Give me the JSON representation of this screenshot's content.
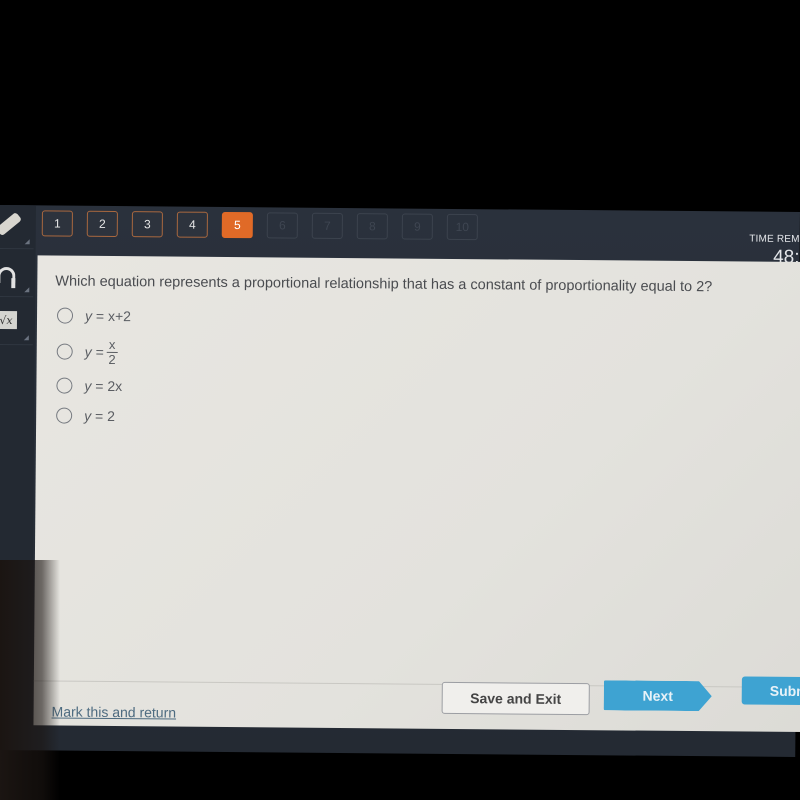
{
  "toolbar": {
    "tools": [
      {
        "name": "pencil",
        "icon": "pencil-icon"
      },
      {
        "name": "text-to-speech",
        "icon": "headphones-icon"
      },
      {
        "name": "calculator",
        "icon": "square-root-icon",
        "glyph": "√x"
      }
    ]
  },
  "question_nav": {
    "items": [
      {
        "label": "1",
        "state": "answered"
      },
      {
        "label": "2",
        "state": "answered"
      },
      {
        "label": "3",
        "state": "answered"
      },
      {
        "label": "4",
        "state": "answered"
      },
      {
        "label": "5",
        "state": "current"
      },
      {
        "label": "6",
        "state": "locked"
      },
      {
        "label": "7",
        "state": "locked"
      },
      {
        "label": "8",
        "state": "locked"
      },
      {
        "label": "9",
        "state": "locked"
      },
      {
        "label": "10",
        "state": "locked"
      }
    ]
  },
  "timer": {
    "label": "TIME REM",
    "value": "48:"
  },
  "question": {
    "text": "Which equation represents a proportional relationship that has a constant of proportionality equal to 2?",
    "choices": [
      {
        "lhs": "y",
        "eq": "=",
        "rhs": "x+2"
      },
      {
        "lhs": "y",
        "eq": "=",
        "numerator": "x",
        "denominator": "2"
      },
      {
        "lhs": "y",
        "eq": "=",
        "rhs": "2x"
      },
      {
        "lhs": "y",
        "eq": "=",
        "rhs": "2"
      }
    ]
  },
  "footer": {
    "mark_link": "Mark this and return",
    "save_label": "Save and Exit",
    "next_label": "Next",
    "submit_label": "Submit"
  },
  "colors": {
    "current_question": "#e06a27",
    "primary_button": "#3ea3d2",
    "link": "#4d6b80"
  }
}
